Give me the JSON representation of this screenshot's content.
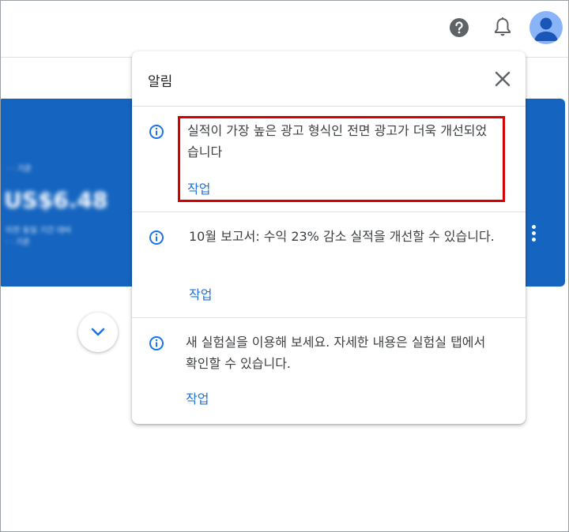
{
  "topbar": {
    "help_icon": "help-circle-icon",
    "bell_icon": "bell-icon",
    "avatar_icon": "account-icon"
  },
  "card": {
    "blurred_caption": "· · 기준",
    "blurred_amount": "US$6.48",
    "blurred_note_1": "이전 동일 기간 대비",
    "blurred_note_2": "· · 기준",
    "accent_color": "#1565c0"
  },
  "panel": {
    "title": "알림",
    "close_icon": "close-icon",
    "notifications": [
      {
        "text": "실적이 가장 높은 광고 형식인 전면 광고가 더욱 개선되었습니다",
        "action": "작업",
        "icon": "info-icon",
        "highlighted": true
      },
      {
        "text": "10월 보고서: 수익 23% 감소 실적을 개선할 수 있습니다.",
        "action": "작업",
        "icon": "info-icon",
        "highlighted": false
      },
      {
        "text": "새 실험실을 이용해 보세요. 자세한 내용은 실험실 탭에서 확인할 수 있습니다.",
        "action": "작업",
        "icon": "info-icon",
        "highlighted": false
      }
    ]
  },
  "colors": {
    "link": "#1a73e8",
    "highlight_border": "#d50000",
    "info_icon": "#1a73e8"
  }
}
